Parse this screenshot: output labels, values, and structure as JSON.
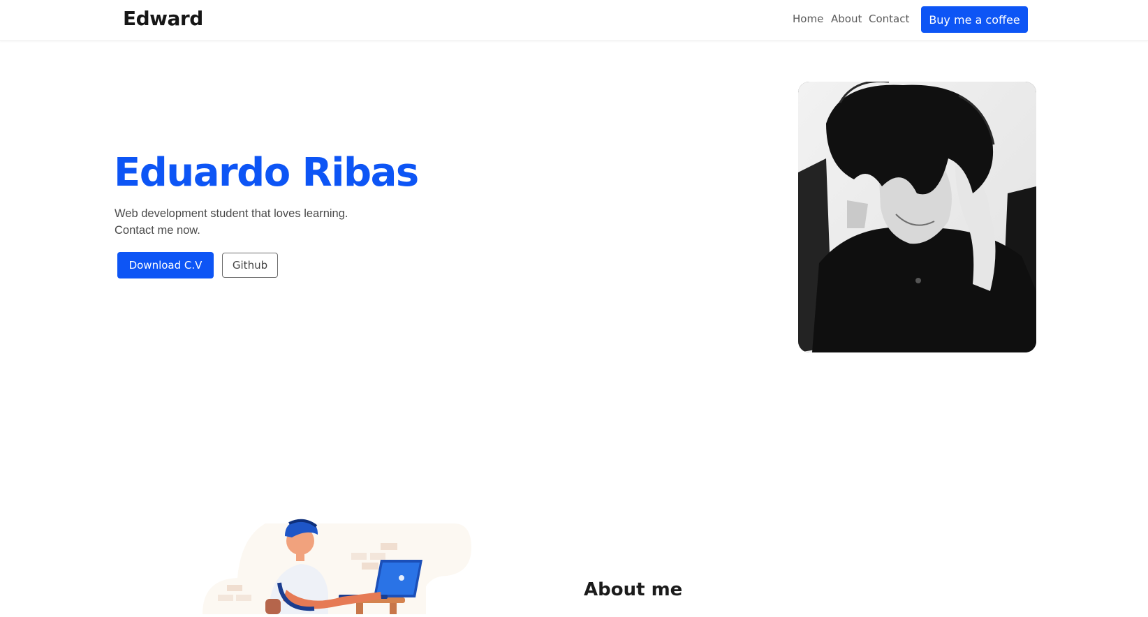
{
  "navbar": {
    "brand": "Edward",
    "links": [
      "Home",
      "About",
      "Contact"
    ],
    "cta_label": "Buy me a coffee"
  },
  "hero": {
    "title": "Eduardo Ribas",
    "description_lines": [
      "Web development student that loves learning.",
      "Contact me now."
    ],
    "primary_button": "Download C.V",
    "secondary_button": "Github"
  },
  "about": {
    "title": "About me"
  },
  "colors": {
    "accent": "#0d55f5",
    "text_dark": "#161616",
    "text_muted": "#4a4a4a"
  }
}
